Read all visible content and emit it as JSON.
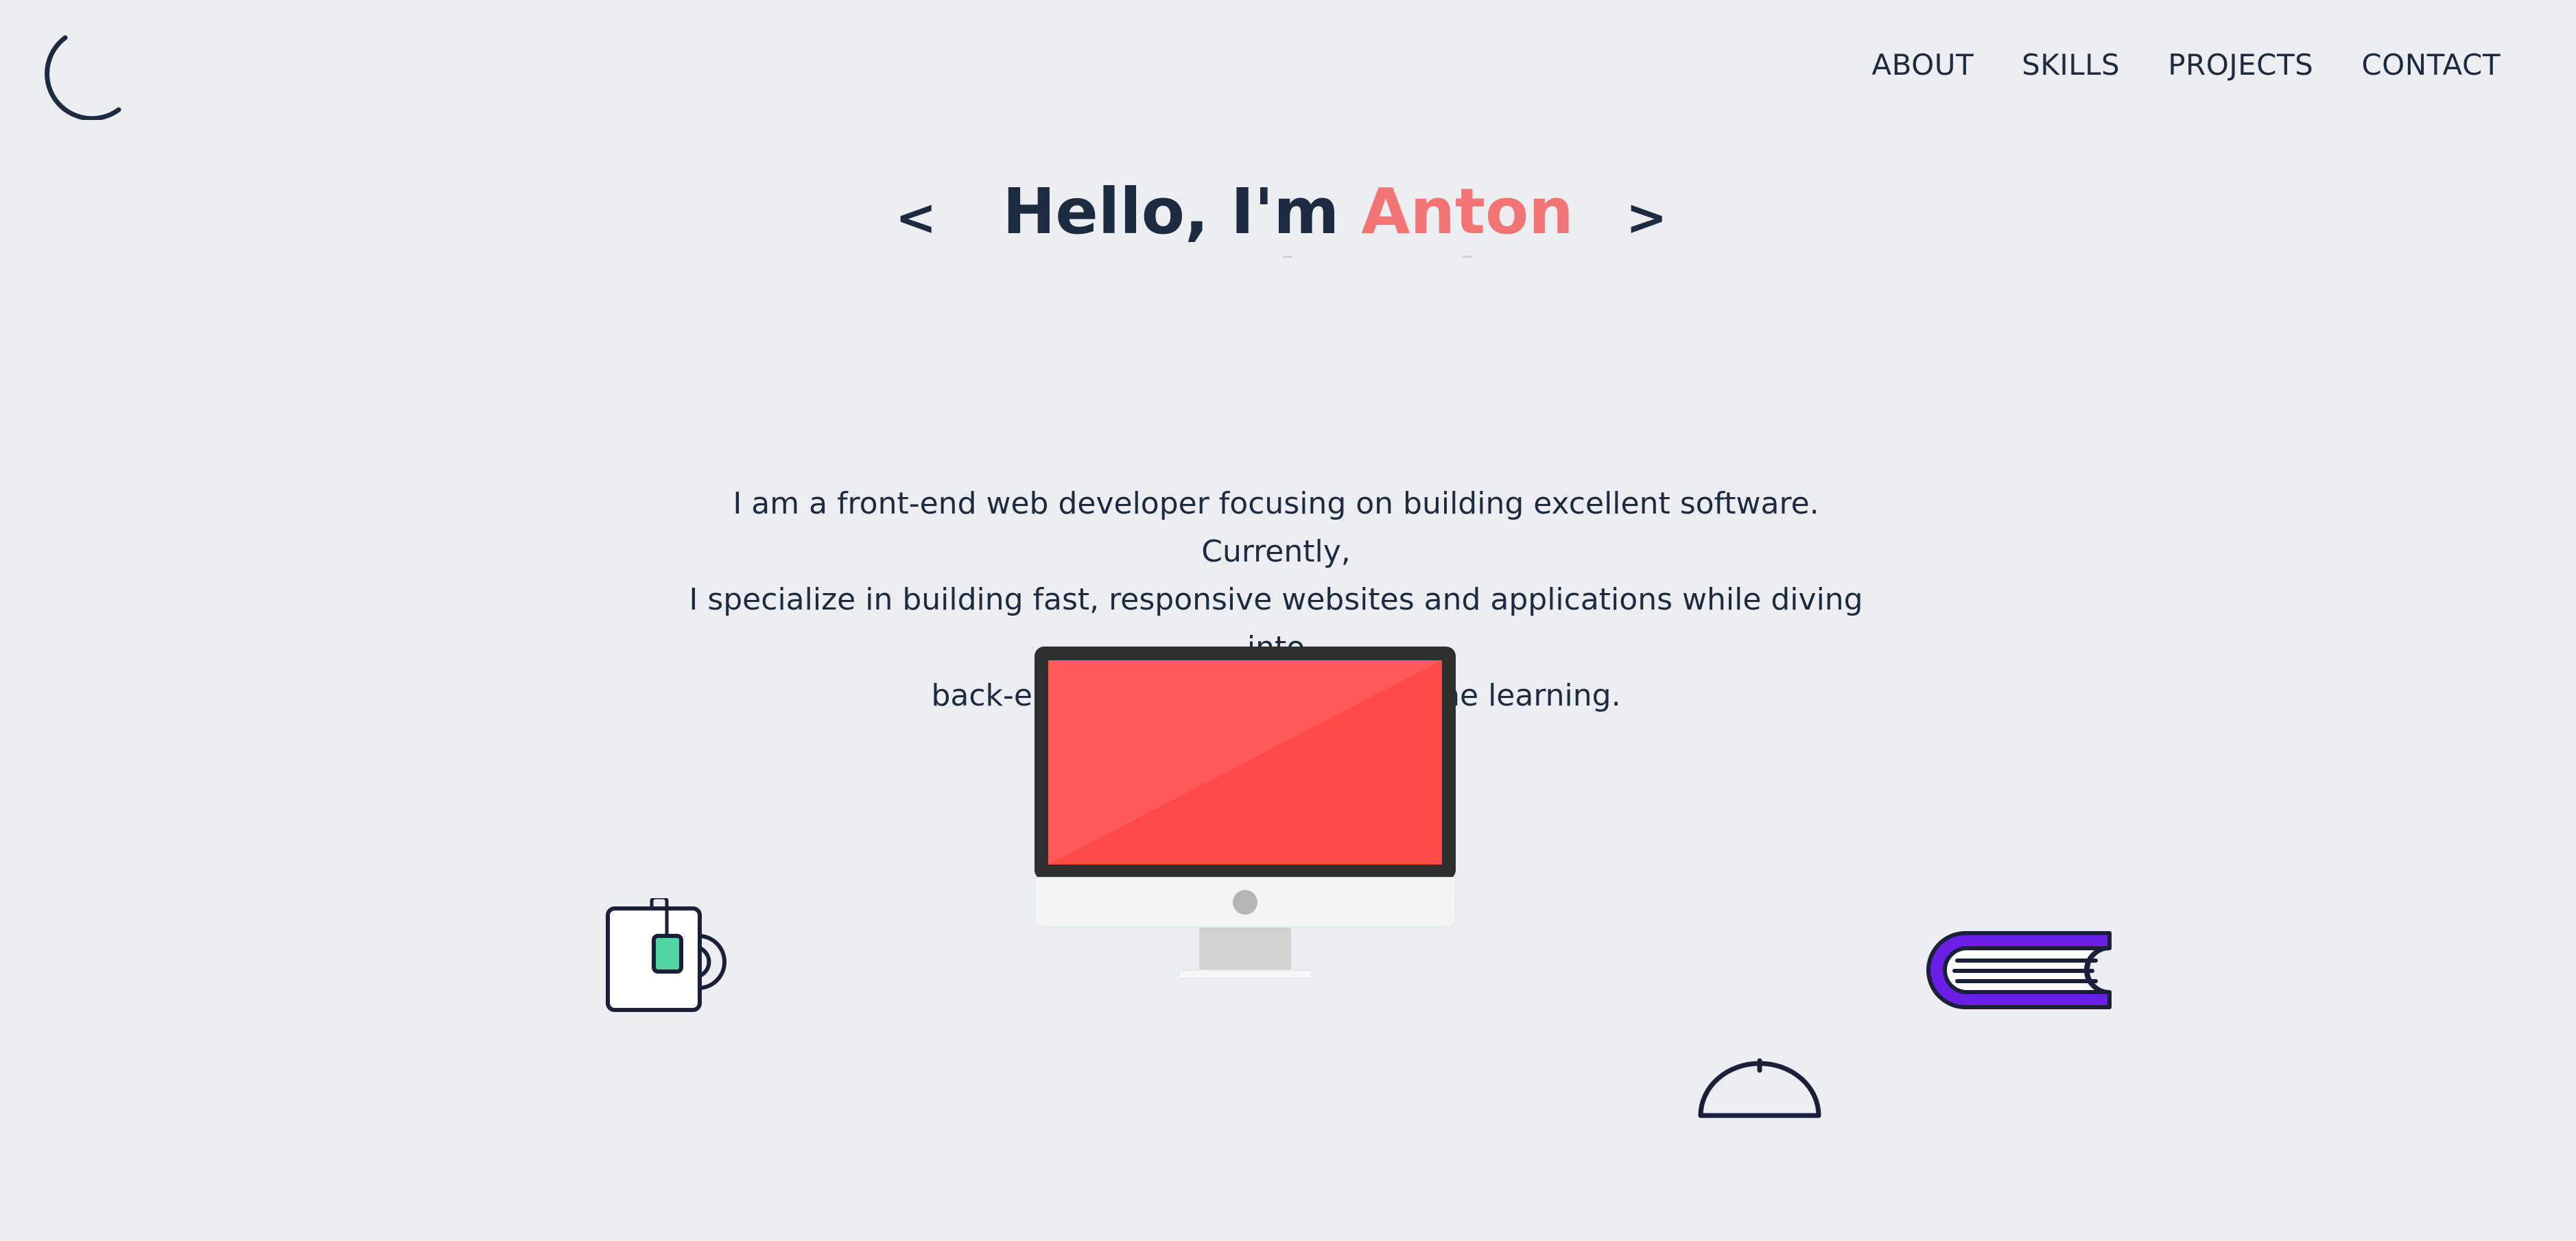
{
  "header": {
    "theme_toggle_icon": "moon-icon",
    "nav": [
      {
        "label": "ABOUT"
      },
      {
        "label": "SKILLS"
      },
      {
        "label": "PROJECTS"
      },
      {
        "label": "CONTACT"
      }
    ]
  },
  "hero": {
    "prev_label": "<",
    "next_label": ">",
    "greeting": "Hello, I'm ",
    "name": "Anton",
    "name_color": "#f37474"
  },
  "intro": {
    "line1": "I am a front-end web developer focusing on building excellent software. Currently,",
    "line2": "I specialize in building fast, responsive websites and applications while diving into",
    "line3": "back-end technologies and machine learning."
  },
  "illustrations": {
    "monitor": "monitor-icon",
    "mug": "tea-mug-icon",
    "book": "book-icon",
    "dome": "dome-icon",
    "screen_color": "#ff5252",
    "book_color": "#6a1ee6",
    "tea_tag_color": "#4fd6a1"
  }
}
